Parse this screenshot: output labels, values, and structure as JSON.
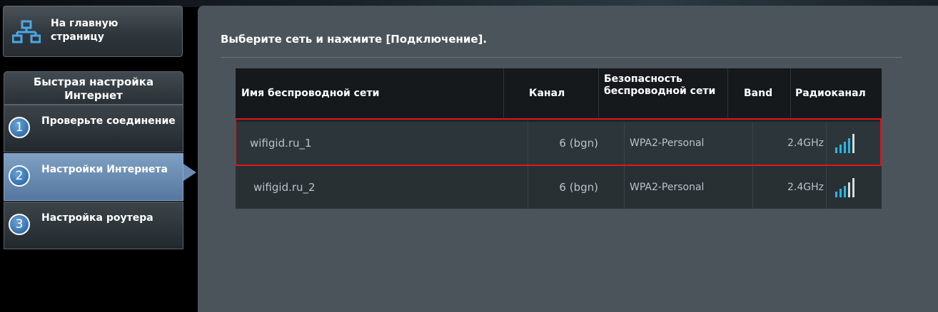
{
  "sidebar": {
    "home_label": "На главную страницу",
    "quick_setup_title": "Быстрая настройка Интернет",
    "steps": [
      {
        "num": "1",
        "label": "Проверьте соединение"
      },
      {
        "num": "2",
        "label": "Настройки Интернета"
      },
      {
        "num": "3",
        "label": "Настройка роутера"
      }
    ],
    "active_step": 2
  },
  "main": {
    "instruction": "Выберите сеть и нажмите [Подключение].",
    "table": {
      "headers": {
        "ssid": "Имя беспроводной сети",
        "channel": "Канал",
        "security": "Безопасность беспроводной сети",
        "band": "Band",
        "signal": "Радиоканал"
      },
      "rows": [
        {
          "ssid": "wifigid.ru_1",
          "channel": "6 (bgn)",
          "security": "WPA2-Personal",
          "band": "2.4GHz",
          "signal_icon": "signal-strength-icon"
        },
        {
          "ssid": "wifigid.ru_2",
          "channel": "6 (bgn)",
          "security": "WPA2-Personal",
          "band": "2.4GHz",
          "signal_icon": "signal-strength-icon"
        }
      ]
    }
  },
  "colors": {
    "accent_blue": "#6b8cb4",
    "highlight_red": "#e0141c",
    "signal_cyan": "#2bb6e6"
  }
}
